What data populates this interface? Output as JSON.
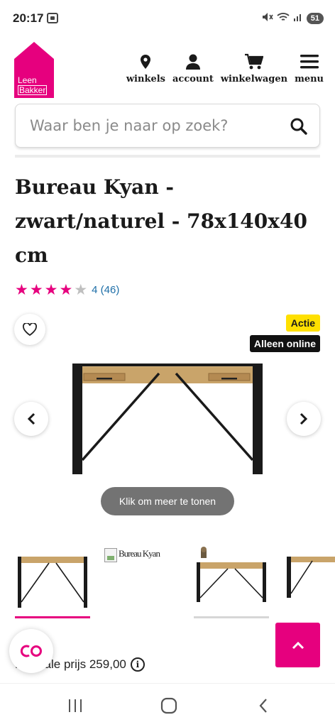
{
  "status_bar": {
    "time": "20:17",
    "battery": "51"
  },
  "brand": {
    "logo_line1": "Leen",
    "logo_line2": "Bakker",
    "accent_color": "#e6007e"
  },
  "nav": {
    "items": [
      {
        "label": "winkels",
        "icon": "map-pin-icon"
      },
      {
        "label": "account",
        "icon": "person-icon"
      },
      {
        "label": "winkelwagen",
        "icon": "cart-icon"
      },
      {
        "label": "menu",
        "icon": "hamburger-icon"
      }
    ]
  },
  "search": {
    "placeholder": "Waar ben je naar op zoek?"
  },
  "product": {
    "title": "Bureau Kyan - zwart/naturel - 78x140x40 cm",
    "rating": 4,
    "rating_max": 5,
    "rating_text": "4 (46)",
    "badge_sale": "Actie",
    "badge_online": "Alleen online",
    "more_label": "Klik om meer te tonen",
    "broken_thumb_text": "Bureau Kyan",
    "price_text": "Normale prijs 259,00"
  }
}
